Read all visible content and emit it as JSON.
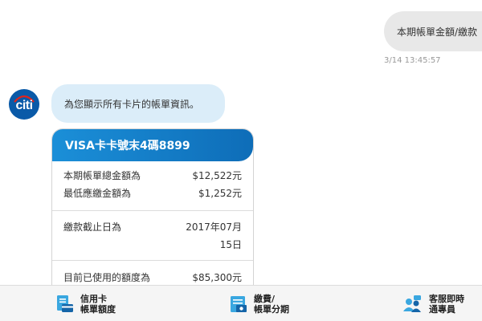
{
  "chat": {
    "user_message": "本期帳單金額/繳款",
    "user_timestamp": "3/14 13:45:57",
    "bot_avatar_text": "citi",
    "bot_message": "為您顯示所有卡片的帳單資訊。"
  },
  "card": {
    "title": "VISA卡卡號末4碼8899",
    "rows": [
      {
        "label": "本期帳單總金額為",
        "value": "$12,522元"
      },
      {
        "label": "最低應繳金額為",
        "value": "$1,252元"
      },
      {
        "label": "繳款截止日為",
        "value_line1": "2017年07月",
        "value_line2": "15日"
      },
      {
        "label": "目前已使用的額度為",
        "value": "$85,300元"
      }
    ]
  },
  "bottom_nav": [
    {
      "line1": "信用卡",
      "line2": "帳單額度",
      "icon": "credit-card-bill-icon"
    },
    {
      "line1": "繳費/",
      "line2": "帳單分期",
      "icon": "payment-installment-icon"
    },
    {
      "line1": "客服即時",
      "line2": "通專員",
      "icon": "customer-service-icon"
    }
  ],
  "colors": {
    "brand_blue": "#0e6db8",
    "bot_bubble": "#dbedf9",
    "user_bubble": "#e8e8e8"
  }
}
